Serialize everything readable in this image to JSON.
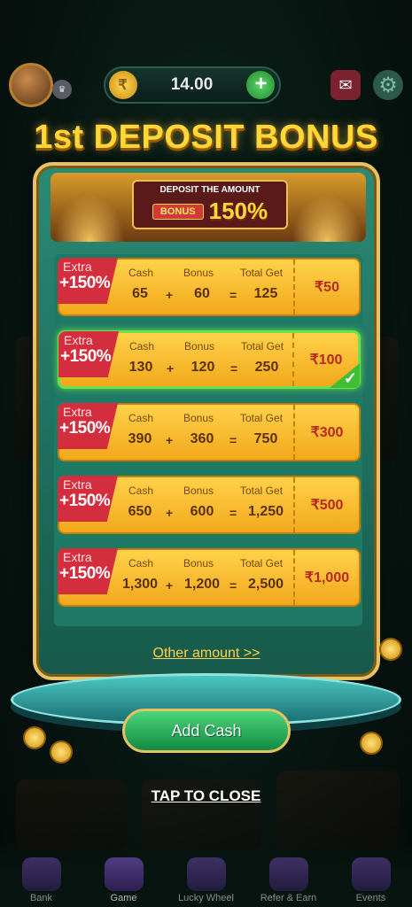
{
  "top_bar": {
    "balance": "14.00",
    "coin_symbol": "₹",
    "add_symbol": "+"
  },
  "title": "1st DEPOSIT BONUS",
  "banner": {
    "caption": "DEPOSIT THE AMOUNT",
    "bonus_tag": "BONUS",
    "percent": "150%"
  },
  "offers": [
    {
      "extra": "Extra",
      "extra_pct": "+150%",
      "cash_label": "Cash",
      "bonus_label": "Bonus",
      "total_label": "Total Get",
      "cash": "65",
      "bonus": "60",
      "total": "125",
      "price": "₹50",
      "selected": false
    },
    {
      "extra": "Extra",
      "extra_pct": "+150%",
      "cash_label": "Cash",
      "bonus_label": "Bonus",
      "total_label": "Total Get",
      "cash": "130",
      "bonus": "120",
      "total": "250",
      "price": "₹100",
      "selected": true
    },
    {
      "extra": "Extra",
      "extra_pct": "+150%",
      "cash_label": "Cash",
      "bonus_label": "Bonus",
      "total_label": "Total Get",
      "cash": "390",
      "bonus": "360",
      "total": "750",
      "price": "₹300",
      "selected": false
    },
    {
      "extra": "Extra",
      "extra_pct": "+150%",
      "cash_label": "Cash",
      "bonus_label": "Bonus",
      "total_label": "Total Get",
      "cash": "650",
      "bonus": "600",
      "total": "1,250",
      "price": "₹500",
      "selected": false
    },
    {
      "extra": "Extra",
      "extra_pct": "+150%",
      "cash_label": "Cash",
      "bonus_label": "Bonus",
      "total_label": "Total Get",
      "cash": "1,300",
      "bonus": "1,200",
      "total": "2,500",
      "price": "₹1,000",
      "selected": false
    }
  ],
  "operators": {
    "plus": "+",
    "equals": "="
  },
  "other_amount": "Other amount >>",
  "add_cash": "Add Cash",
  "tap_to_close": "TAP TO CLOSE",
  "bottom_nav": [
    {
      "label": "Bank",
      "icon": "bank-icon"
    },
    {
      "label": "Game",
      "icon": "slot-777-icon"
    },
    {
      "label": "Lucky Wheel",
      "icon": "wheel-icon"
    },
    {
      "label": "Refer & Earn",
      "icon": "refer-icon"
    },
    {
      "label": "Events",
      "icon": "gift-icon"
    }
  ],
  "colors": {
    "title": "#ffd93a",
    "panel": "#2a8a74",
    "offer": "#ffd24a",
    "price": "#b8281c",
    "selected_border": "#6ce24a",
    "add_cash": "#4ad57a"
  }
}
